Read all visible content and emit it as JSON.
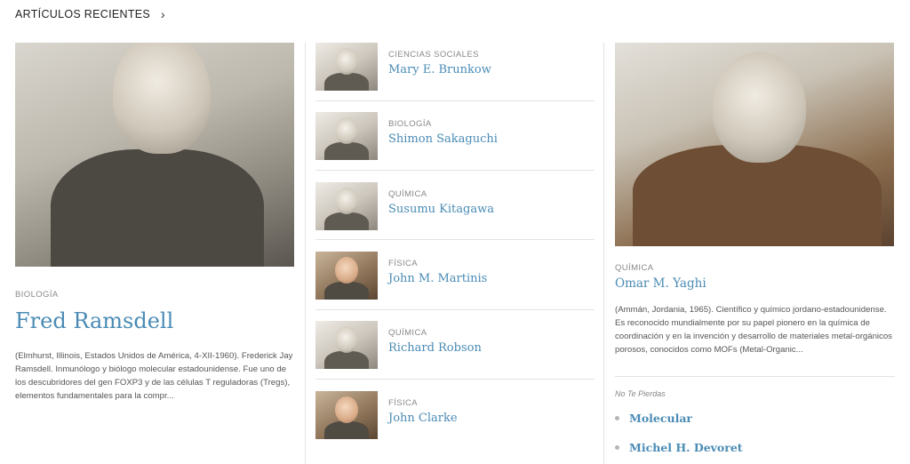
{
  "header": {
    "title": "ARTÍCULOS RECIENTES"
  },
  "featured_left": {
    "category": "BIOLOGÍA",
    "name": "Fred Ramsdell",
    "excerpt": "(Elmhurst, Illinois, Estados Unidos de América, 4-XII-1960). Frederick Jay Ramsdell. Inmunólogo y biólogo molecular estadounidense. Fue uno de los descubridores del gen FOXP3 y de las células T reguladoras (Tregs), elementos fundamentales para la compr..."
  },
  "middle_list": [
    {
      "category": "CIENCIAS SOCIALES",
      "name": "Mary E. Brunkow"
    },
    {
      "category": "BIOLOGÍA",
      "name": "Shimon Sakaguchi"
    },
    {
      "category": "QUÍMICA",
      "name": "Susumu Kitagawa"
    },
    {
      "category": "FÍSICA",
      "name": "John M. Martinis"
    },
    {
      "category": "QUÍMICA",
      "name": "Richard Robson"
    },
    {
      "category": "FÍSICA",
      "name": "John Clarke"
    }
  ],
  "featured_right": {
    "category": "QUÍMICA",
    "name": "Omar M. Yaghi",
    "excerpt": "(Ammán, Jordania, 1965). Científico y químico jordano-estadounidense. Es reconocido mundialmente por su papel pionero en la química de coordinación y en la invención y desarrollo de materiales metal-orgánicos porosos, conocidos como MOFs (Metal-Organic..."
  },
  "dont_miss": {
    "label": "No Te Pierdas",
    "items": [
      "Molecular",
      "Michel H. Devoret"
    ]
  }
}
